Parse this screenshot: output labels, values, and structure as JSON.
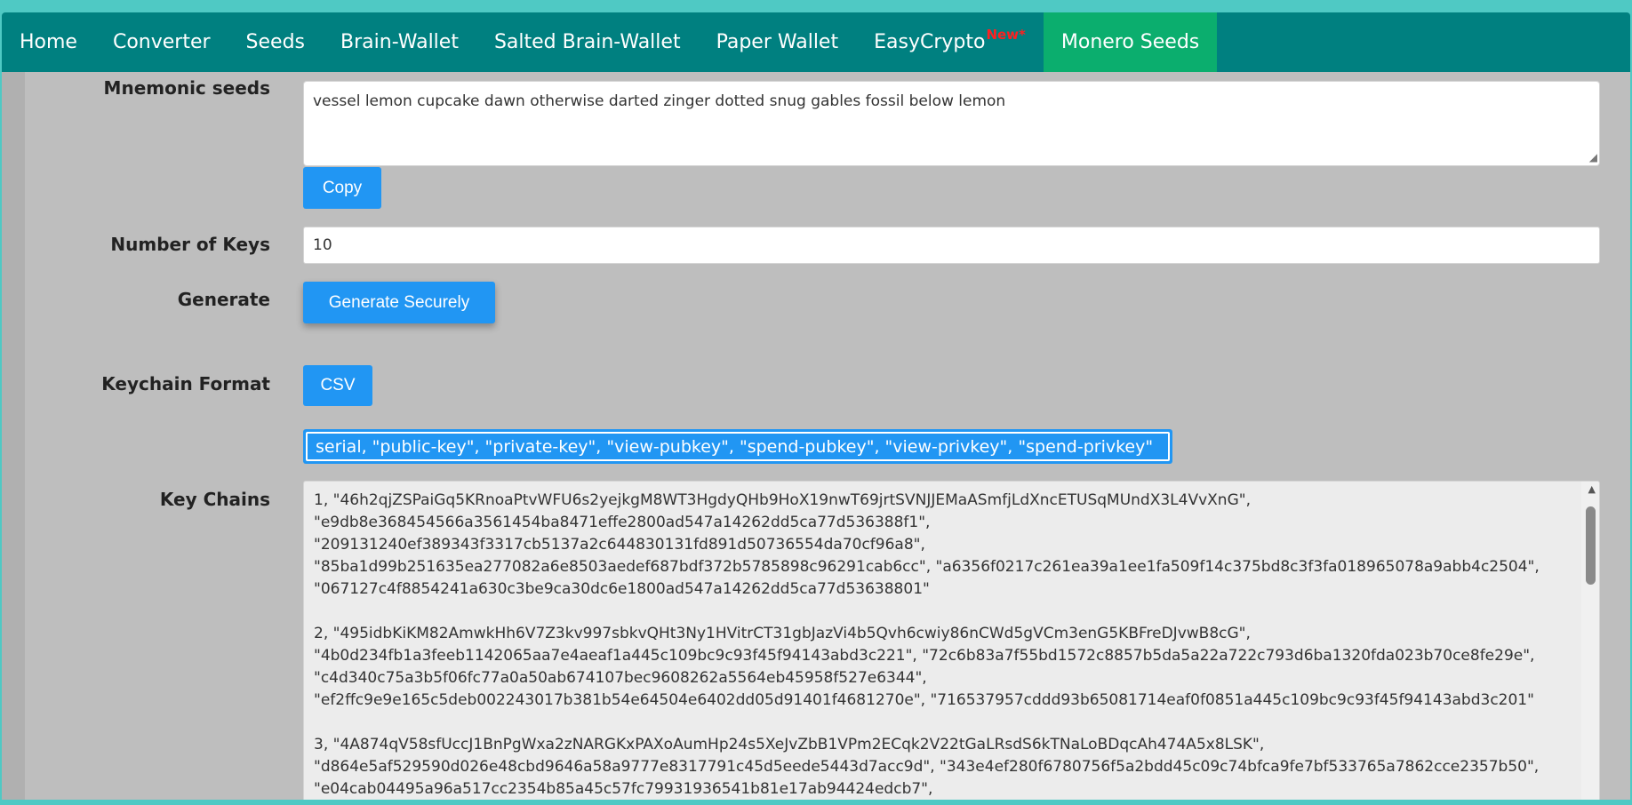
{
  "nav": {
    "items": [
      "Home",
      "Converter",
      "Seeds",
      "Brain-Wallet",
      "Salted Brain-Wallet",
      "Paper Wallet"
    ],
    "easycrypto_label": "EasyCrypto",
    "easycrypto_badge": "New*",
    "active_label": "Monero Seeds"
  },
  "form": {
    "mnemonic_label": "Mnemonic seeds",
    "mnemonic_value": "vessel lemon cupcake dawn otherwise darted zinger dotted snug gables fossil below lemon",
    "copy_label": "Copy",
    "numkeys_label": "Number of Keys",
    "numkeys_value": "10",
    "generate_label": "Generate",
    "generate_button": "Generate Securely",
    "format_label": "Keychain Format",
    "format_button": "CSV",
    "format_columns": "serial, \"public-key\", \"private-key\", \"view-pubkey\", \"spend-pubkey\", \"view-privkey\", \"spend-privkey\"",
    "chains_label": "Key Chains"
  },
  "key_chains": [
    [
      "1, \"46h2qjZSPaiGq5KRnoaPtvWFU6s2yejkgM8WT3HgdyQHb9HoX19nwT69jrtSVNJJEMaASmfjLdXncETUSqMUndX3L4VvXnG\",",
      "\"e9db8e368454566a3561454ba8471effe2800ad547a14262dd5ca77d536388f1\",",
      "\"209131240ef389343f3317cb5137a2c644830131fd891d50736554da70cf96a8\",",
      "\"85ba1d99b251635ea277082a6e8503aedef687bdf372b5785898c96291cab6cc\", \"a6356f0217c261ea39a1ee1fa509f14c375bd8c3f3fa018965078a9abb4c2504\",",
      "\"067127c4f8854241a630c3be9ca30dc6e1800ad547a14262dd5ca77d53638801\""
    ],
    [
      "2, \"495idbKiKM82AmwkHh6V7Z3kv997sbkvQHt3Ny1HVitrCT31gbJazVi4b5Qvh6cwiy86nCWd5gVCm3enG5KBFreDJvwB8cG\",",
      "\"4b0d234fb1a3feeb1142065aa7e4aeaf1a445c109bc9c93f45f94143abd3c221\", \"72c6b83a7f55bd1572c8857b5da5a22a722c793d6ba1320fda023b70ce8fe29e\",",
      "\"c4d340c75a3b5f06fc77a0a50ab674107bec9608262a5564eb45958f527e6344\",",
      "\"ef2ffc9e9e165c5deb002243017b381b54e64504e6402dd05d91401f4681270e\", \"716537957cddd93b65081714eaf0f0851a445c109bc9c93f45f94143abd3c201\""
    ],
    [
      "3, \"4A874qV58sfUccJ1BnPgWxa2zNARGKxPAXoAumHp24s5XeJvZbB1VPm2ECqk2V22tGaLRsdS6kTNaLoBDqcAh474A5x8LSK\",",
      "\"d864e5af529590d026e48cbd9646a58a9777e8317791c45d5eede5443d7acc9d\", \"343e4ef280f6780756f5a2bdd45c09c74bfca9fe7bf533765a7862cce2357b50\",",
      "\"e04cab04495a96a517cc2354b85a45c57fc79931936541b81e17ab94424edcb7\","
    ]
  ]
}
